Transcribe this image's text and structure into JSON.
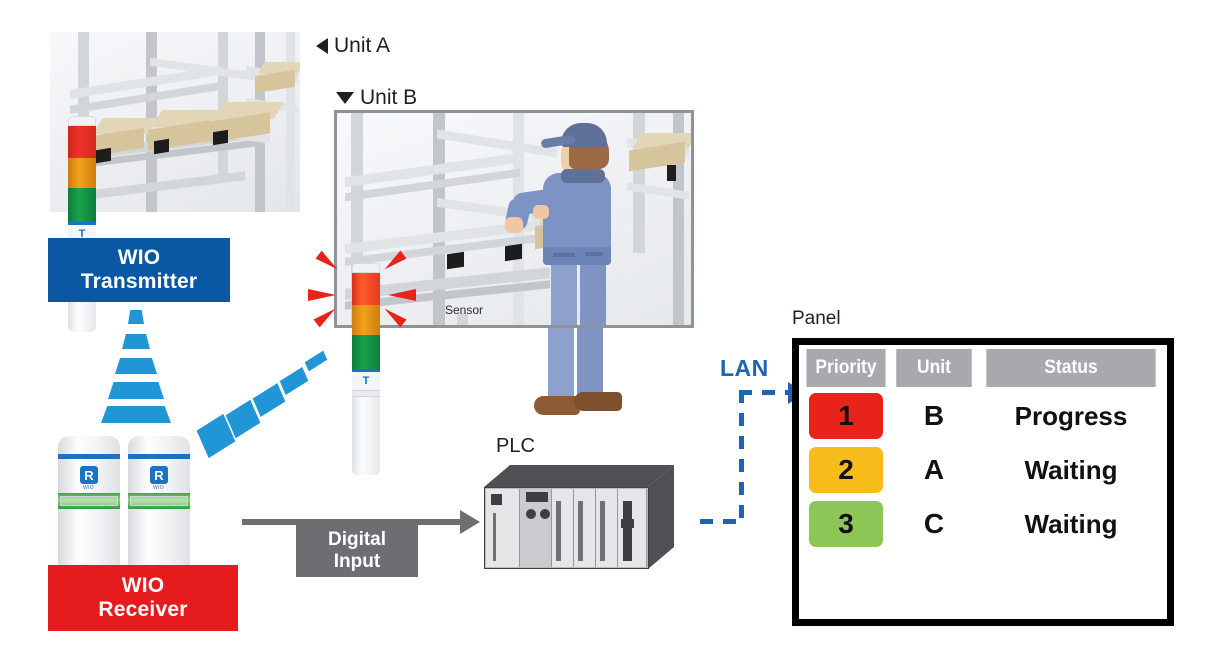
{
  "diagram": {
    "units": [
      {
        "id": "unit-a",
        "label": "Unit A",
        "marker": "triangle-left"
      },
      {
        "id": "unit-b",
        "label": "Unit B",
        "marker": "triangle-down"
      }
    ],
    "scene_b": {
      "sensor_label": "Sensor"
    },
    "tags": {
      "transmitter": {
        "line1": "WIO",
        "line2": "Transmitter",
        "color": "#0a57a4"
      },
      "receiver": {
        "line1": "WIO",
        "line2": "Receiver",
        "color": "#e51b1e"
      }
    },
    "tower": {
      "badge": "T",
      "sub": "WIO"
    },
    "receiver_unit": {
      "badge": "R",
      "sub": "WIO"
    },
    "digital_input": {
      "line1": "Digital",
      "line2": "Input",
      "color": "#6d6e71"
    },
    "plc": {
      "label": "PLC"
    },
    "lan": {
      "label": "LAN",
      "color": "#1f64b0"
    },
    "panel": {
      "title": "Panel",
      "columns": [
        "Priority",
        "Unit",
        "Status"
      ],
      "rows": [
        {
          "priority": "1",
          "unit": "B",
          "status": "Progress",
          "color": "#e8231a"
        },
        {
          "priority": "2",
          "unit": "A",
          "status": "Waiting",
          "color": "#f5bc1a"
        },
        {
          "priority": "3",
          "unit": "C",
          "status": "Waiting",
          "color": "#8dc556"
        }
      ]
    }
  }
}
